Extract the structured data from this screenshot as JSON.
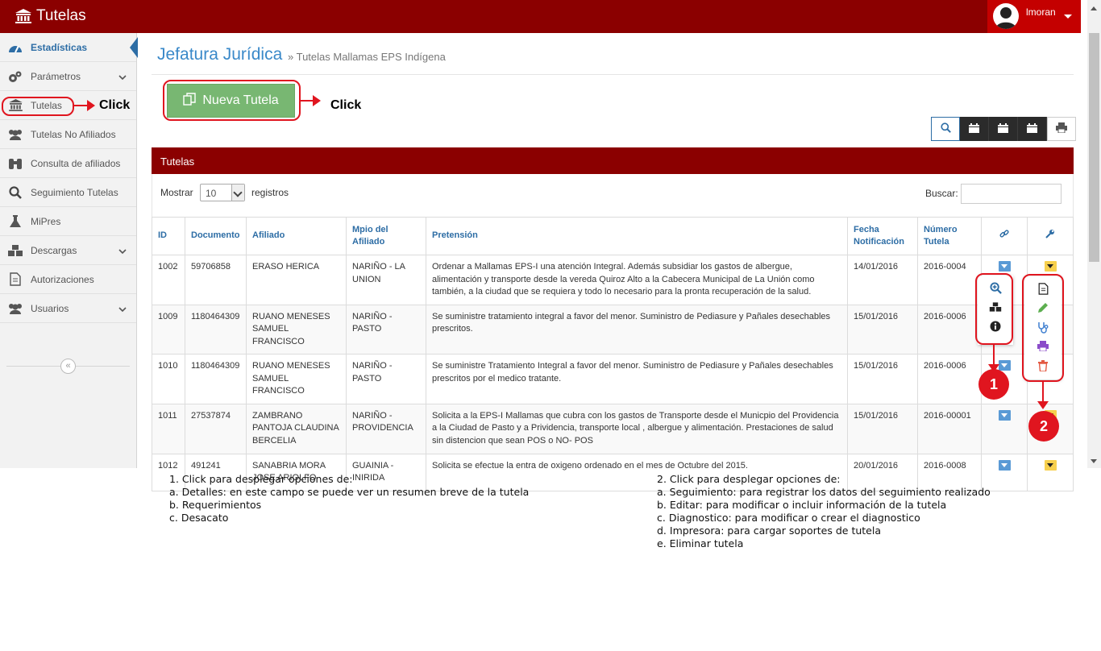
{
  "app": {
    "title": "Tutelas",
    "user": "lmoran"
  },
  "sidebar": {
    "items": [
      {
        "label": "Estadísticas",
        "icon": "dashboard-icon"
      },
      {
        "label": "Parámetros",
        "icon": "gears-icon"
      },
      {
        "label": "Tutelas",
        "icon": "bank-icon"
      },
      {
        "label": "Tutelas No Afiliados",
        "icon": "users-icon"
      },
      {
        "label": "Consulta de afiliados",
        "icon": "binoculars-icon"
      },
      {
        "label": "Seguimiento Tutelas",
        "icon": "search-icon"
      },
      {
        "label": "MiPres",
        "icon": "flask-icon"
      },
      {
        "label": "Descargas",
        "icon": "cubes-icon"
      },
      {
        "label": "Autorizaciones",
        "icon": "document-icon"
      },
      {
        "label": "Usuarios",
        "icon": "users-icon"
      }
    ],
    "collapse_glyph": "«"
  },
  "page": {
    "title": "Jefatura Jurídica",
    "breadcrumb": "» Tutelas Mallamas EPS Indígena"
  },
  "new_button": {
    "label": "Nueva Tutela"
  },
  "annotations": {
    "click_sidebar": "Click",
    "click_button": "Click",
    "badge1": "1",
    "badge2": "2"
  },
  "panel": {
    "title": "Tutelas",
    "show_label": "Mostrar",
    "page_size": "10",
    "records_label": "registros",
    "search_label": "Buscar:"
  },
  "table": {
    "columns": [
      "ID",
      "Documento",
      "Afiliado",
      "Mpio del Afiliado",
      "Pretensión",
      "Fecha Notificación",
      "Número Tutela"
    ],
    "rows": [
      {
        "id": "1002",
        "doc": "59706858",
        "afiliado": "ERASO HERICA",
        "mpio": "NARIÑO - LA UNION",
        "pretension": "Ordenar a Mallamas EPS-I una atención Integral. Además subsidiar los gastos de albergue, alimentación y transporte desde la vereda Quiroz Alto a la Cabecera Municipal de La Unión como también, a la ciudad que se requiera y todo lo necesario para la pronta recuperación de la salud.",
        "fecha": "14/01/2016",
        "numero": "2016-0004"
      },
      {
        "id": "1009",
        "doc": "1180464309",
        "afiliado": "RUANO MENESES SAMUEL FRANCISCO",
        "mpio": "NARIÑO - PASTO",
        "pretension": "Se suministre tratamiento integral a favor del menor. Suministro de Pediasure y Pañales desechables prescritos.",
        "fecha": "15/01/2016",
        "numero": "2016-0006"
      },
      {
        "id": "1010",
        "doc": "1180464309",
        "afiliado": "RUANO MENESES SAMUEL FRANCISCO",
        "mpio": "NARIÑO - PASTO",
        "pretension": "Se suministre Tratamiento Integral a favor del menor. Suministro de Pediasure y Pañales desechables prescritos por el medico tratante.",
        "fecha": "15/01/2016",
        "numero": "2016-0006"
      },
      {
        "id": "1011",
        "doc": "27537874",
        "afiliado": "ZAMBRANO PANTOJA CLAUDINA BERCELIA",
        "mpio": "NARIÑO - PROVIDENCIA",
        "pretension": "Solicita a la EPS-I Mallamas que cubra con los gastos de Transporte desde el Municpio del Providencia a la Ciudad de Pasto y a Prividencia, transporte local , albergue y alimentación. Prestaciones de salud sin distencion que sean POS o NO- POS",
        "fecha": "15/01/2016",
        "numero": "2016-00001"
      },
      {
        "id": "1012",
        "doc": "491241",
        "afiliado": "SANABRIA MORA JOSE ARIOLFO",
        "mpio": "GUAINIA - INIRIDA",
        "pretension": "Solicita se efectue la entra de oxigeno ordenado en el mes de Octubre del 2015.",
        "fecha": "20/01/2016",
        "numero": "2016-0008"
      }
    ]
  },
  "notes": {
    "left": [
      "1. Click para desplegar opciones de:",
      "a. Detalles: en este campo se puede ver un resumen breve de la tutela",
      "b. Requerimientos",
      "c. Desacato"
    ],
    "right": [
      "2. Click para desplegar opciones de:",
      "a. Seguimiento: para registrar los datos del seguimiento realizado",
      "b. Editar: para modificar o incluir información de la tutela",
      "c. Diagnostico: para modificar o crear el diagnostico",
      "d. Impresora: para cargar soportes de tutela",
      "e. Eliminar tutela"
    ]
  },
  "colors": {
    "brand": "#8b0000",
    "user_bg": "#c40000",
    "accent": "#2d6da5",
    "new_button": "#78b772",
    "annotation": "#e0151f"
  }
}
